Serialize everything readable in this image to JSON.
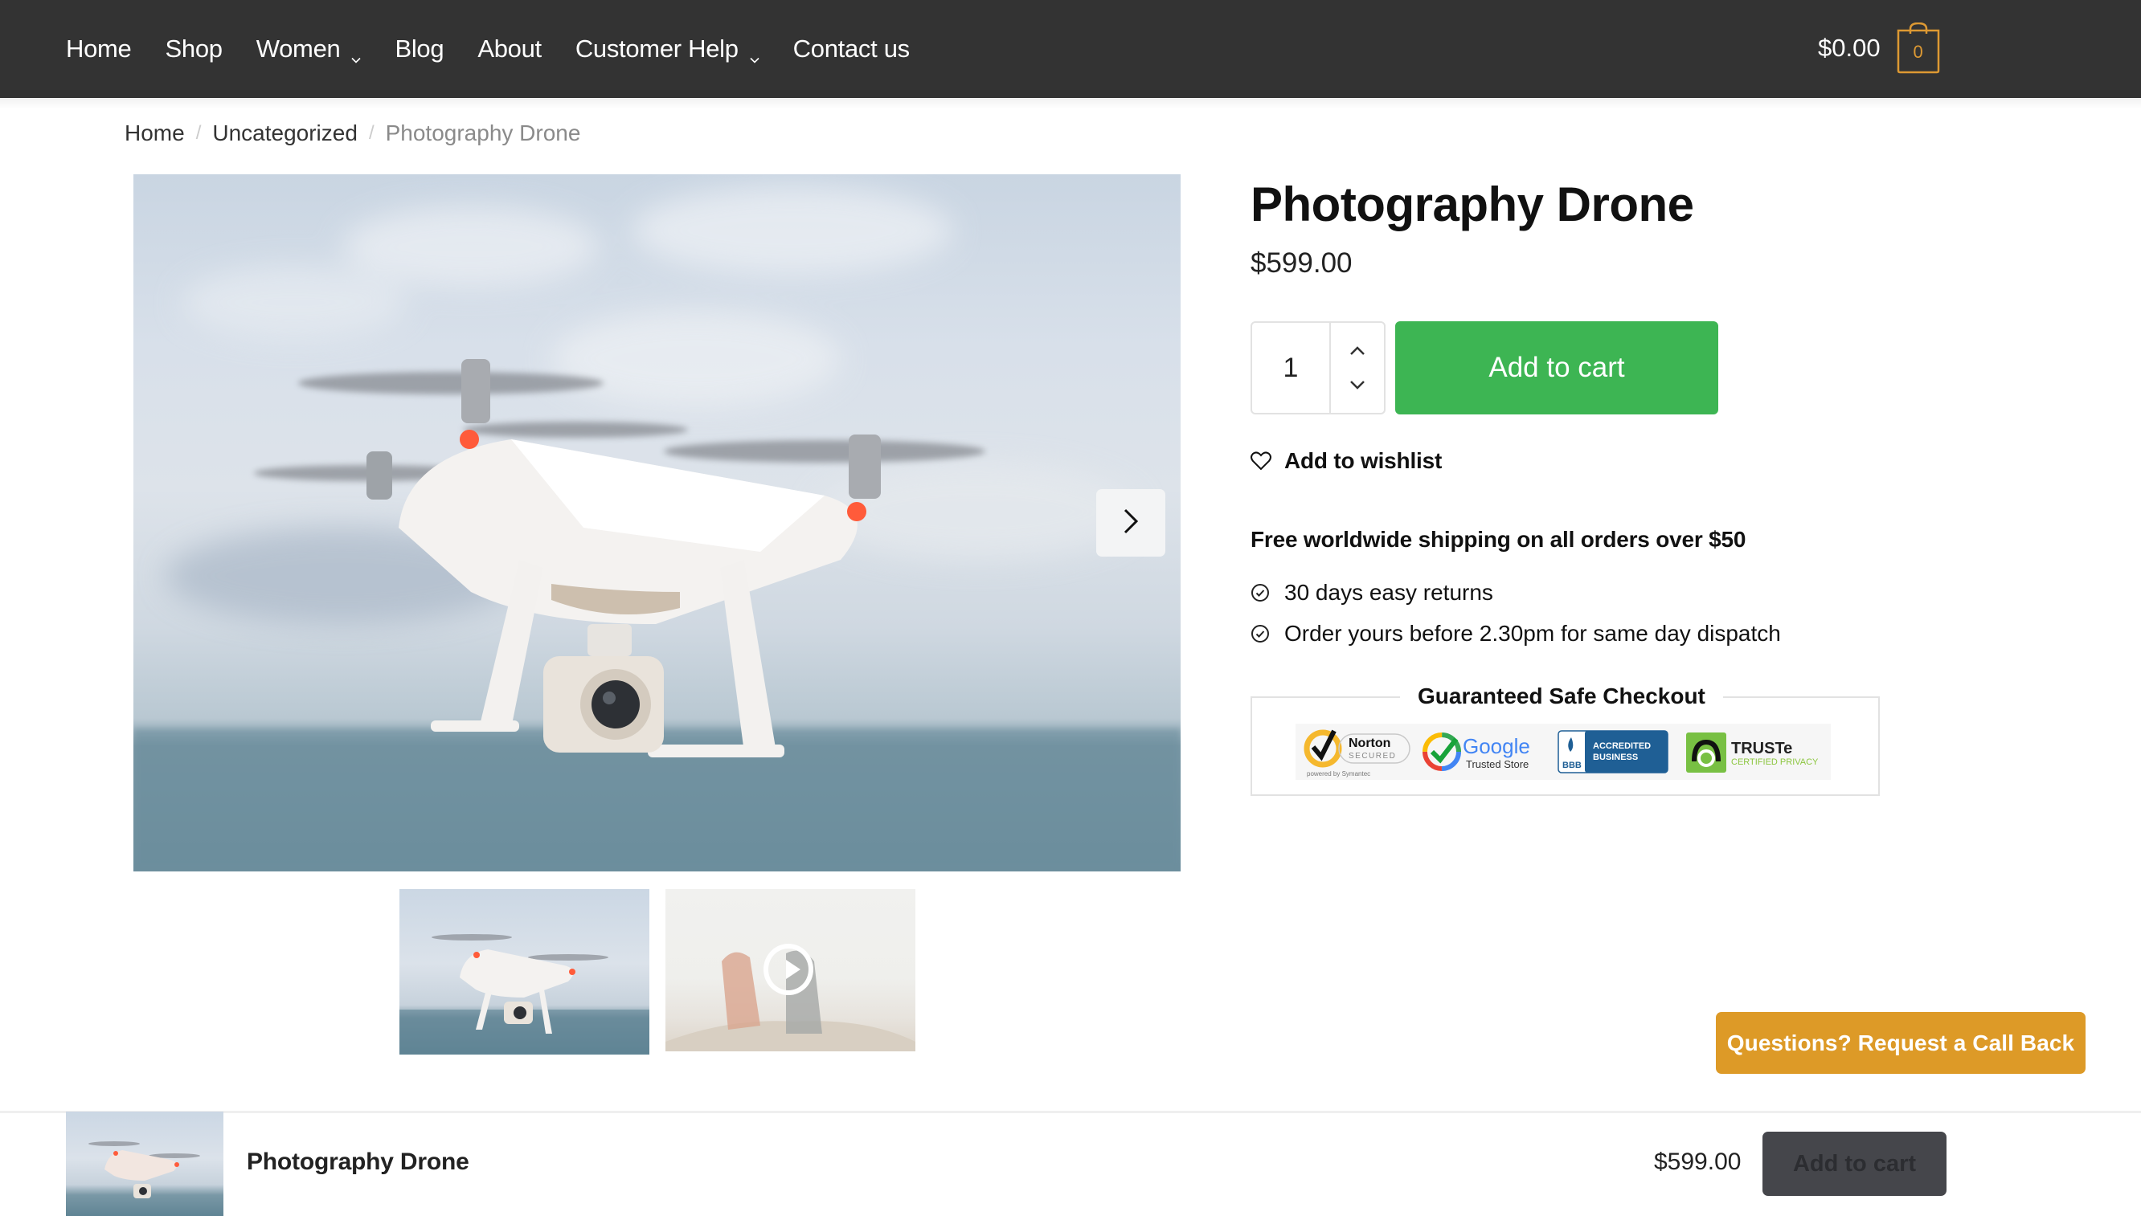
{
  "header": {
    "nav": [
      {
        "label": "Home",
        "has_dropdown": false
      },
      {
        "label": "Shop",
        "has_dropdown": false
      },
      {
        "label": "Women",
        "has_dropdown": true
      },
      {
        "label": "Blog",
        "has_dropdown": false
      },
      {
        "label": "About",
        "has_dropdown": false
      },
      {
        "label": "Customer Help",
        "has_dropdown": true
      },
      {
        "label": "Contact us",
        "has_dropdown": false
      }
    ],
    "cart_total": "$0.00",
    "cart_count": "0",
    "cart_icon": "shopping-bag-icon",
    "colors": {
      "background": "#333333",
      "accent": "#dd9933"
    }
  },
  "breadcrumb": {
    "items": [
      "Home",
      "Uncategorized"
    ],
    "separator": "/",
    "current": "Photography Drone"
  },
  "gallery": {
    "main_image_alt": "White quadcopter drone flying over the sea",
    "next_icon": "chevron-right-icon",
    "thumbnails": [
      {
        "alt": "Photography drone thumbnail",
        "type": "image",
        "active": true
      },
      {
        "alt": "Couple sitting on a rock video thumbnail",
        "type": "video",
        "icon": "play-icon",
        "active": false
      }
    ]
  },
  "product": {
    "title": "Photography Drone",
    "price": "$599.00",
    "quantity": "1",
    "add_to_cart_label": "Add to cart",
    "wishlist_label": "Add to wishlist",
    "shipping_note": "Free worldwide shipping on all orders over $50",
    "perks": [
      "30 days easy returns",
      "Order yours before 2.30pm for same day dispatch"
    ],
    "colors": {
      "add_to_cart": "#3db553"
    }
  },
  "safe_checkout": {
    "title": "Guaranteed Safe Checkout",
    "badges": [
      {
        "name": "Norton Secured",
        "line1": "Norton",
        "line2": "SECURED",
        "line3": "powered by Symantec"
      },
      {
        "name": "Google Trusted Store",
        "line1": "Google",
        "line2": "Trusted Store"
      },
      {
        "name": "BBB Accredited Business",
        "line1": "ACCREDITED",
        "line2": "BUSINESS",
        "logo": "BBB"
      },
      {
        "name": "TRUSTe Certified Privacy",
        "line1": "TRUSTe",
        "line2": "CERTIFIED PRIVACY"
      }
    ]
  },
  "callback": {
    "label": "Questions? Request a Call Back",
    "color": "#dd9a27"
  },
  "sticky_bar": {
    "title": "Photography Drone",
    "price": "$599.00",
    "add_to_cart_label": "Add to cart"
  }
}
